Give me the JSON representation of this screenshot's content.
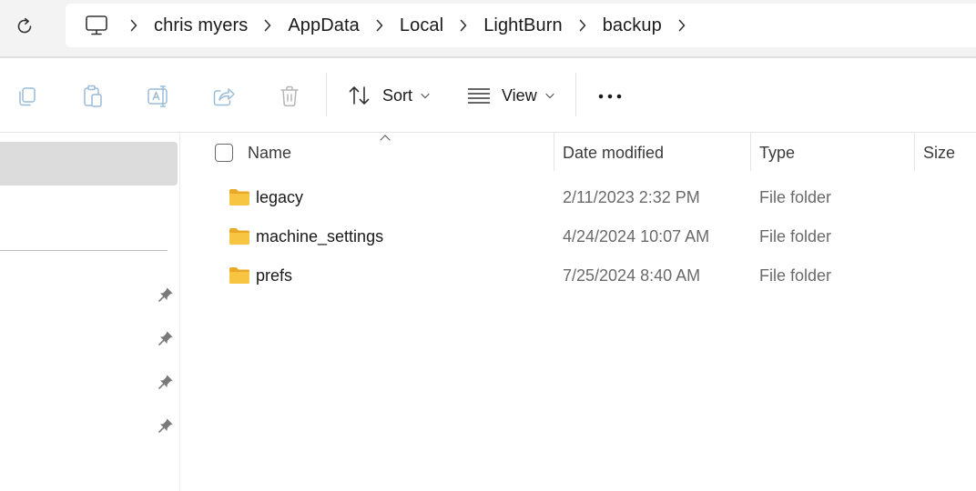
{
  "breadcrumb": {
    "items": [
      {
        "label": "chris myers"
      },
      {
        "label": "AppData"
      },
      {
        "label": "Local"
      },
      {
        "label": "LightBurn"
      },
      {
        "label": "backup"
      }
    ]
  },
  "toolbar": {
    "sort_label": "Sort",
    "view_label": "View",
    "icons": [
      "copy-icon",
      "paste-icon",
      "rename-icon",
      "share-icon",
      "delete-icon",
      "sort-icon",
      "view-icon",
      "more-icon"
    ]
  },
  "columns": {
    "name": "Name",
    "date_modified": "Date modified",
    "type": "Type",
    "size": "Size"
  },
  "files": [
    {
      "name": "legacy",
      "date": "2/11/2023 2:32 PM",
      "type": "File folder"
    },
    {
      "name": "machine_settings",
      "date": "4/24/2024 10:07 AM",
      "type": "File folder"
    },
    {
      "name": "prefs",
      "date": "7/25/2024 8:40 AM",
      "type": "File folder"
    }
  ],
  "colors": {
    "folder": "#f8c542",
    "selected_nav": "#dcdcdc",
    "icon_disabled": "#9bbcd8"
  }
}
